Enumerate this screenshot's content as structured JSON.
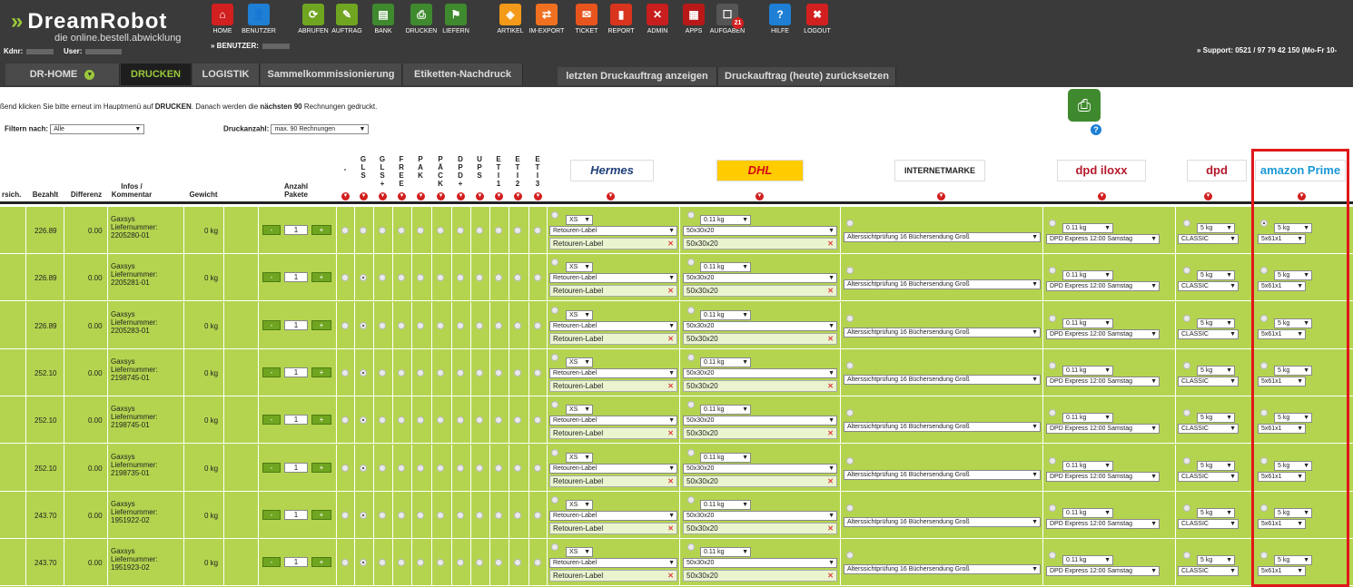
{
  "brand": {
    "name": "DreamRobot",
    "tagline": "die online.bestell.abwicklung"
  },
  "account": {
    "kdnr_label": "Kdnr:",
    "user_label": "User:",
    "benutzer_label": "» BENUTZER:"
  },
  "support": "» Support: 0521 / 97 79 42 150 (Mo-Fr 10-",
  "nav": [
    {
      "label": "HOME",
      "icon": "home-icon",
      "glyph": "⌂",
      "color": "#d21f1f"
    },
    {
      "label": "BENUTZER",
      "icon": "users-icon",
      "glyph": "👤",
      "color": "#1e7fd4"
    },
    {
      "label": "ABRUFEN",
      "icon": "download-icon",
      "glyph": "⟳",
      "color": "#6fa520"
    },
    {
      "label": "AUFTRAG",
      "icon": "order-icon",
      "glyph": "✎",
      "color": "#6fa520"
    },
    {
      "label": "BANK",
      "icon": "bank-icon",
      "glyph": "▤",
      "color": "#3f8a2e"
    },
    {
      "label": "DRUCKEN",
      "icon": "printer-icon",
      "glyph": "⎙",
      "color": "#3f8a2e"
    },
    {
      "label": "LIEFERN",
      "icon": "delivery-icon",
      "glyph": "⚑",
      "color": "#3f8a2e"
    },
    {
      "label": "ARTIKEL",
      "icon": "box-icon",
      "glyph": "◈",
      "color": "#f39a1a"
    },
    {
      "label": "IM-EXPORT",
      "icon": "import-export-icon",
      "glyph": "⇄",
      "color": "#f07020"
    },
    {
      "label": "TICKET",
      "icon": "mail-icon",
      "glyph": "✉",
      "color": "#e8541e"
    },
    {
      "label": "REPORT",
      "icon": "chart-icon",
      "glyph": "▮",
      "color": "#d9341e"
    },
    {
      "label": "ADMIN",
      "icon": "tools-icon",
      "glyph": "✕",
      "color": "#c81e1e"
    },
    {
      "label": "APPS",
      "icon": "apps-icon",
      "glyph": "▦",
      "color": "#b81818"
    },
    {
      "label": "AUFGABEN",
      "icon": "tasks-icon",
      "glyph": "☐",
      "color": "#555555",
      "badge": "21"
    },
    {
      "label": "HILFE",
      "icon": "help-icon",
      "glyph": "?",
      "color": "#1e7fd4"
    },
    {
      "label": "LOGOUT",
      "icon": "logout-icon",
      "glyph": "✖",
      "color": "#d21f1f"
    }
  ],
  "tabs": [
    "DR-HOME",
    "DRUCKEN",
    "LOGISTIK",
    "Sammelkommissionierung",
    "Etiketten-Nachdruck"
  ],
  "actions": [
    "letzten Druckauftrag anzeigen",
    "Druckauftrag (heute) zurücksetzen"
  ],
  "info": {
    "pre": "ßend klicken Sie bitte erneut im Hauptmenü auf ",
    "b1": "DRUCKEN",
    "mid": ". Danach werden die ",
    "b2": "nächsten 90",
    "post": " Rechnungen gedruckt."
  },
  "filter": {
    "label": "Filtern nach:",
    "value": "Alle"
  },
  "druckanzahl": {
    "label": "Druckanzahl:",
    "value": "max. 90 Rechnungen"
  },
  "headers": {
    "versich": "rsich.",
    "bezahlt": "Bezahlt",
    "differenz": "Differenz",
    "infos": "Infos /\nKommentar",
    "gewicht": "Gewicht",
    "pakete": "Anzahl\nPakete"
  },
  "carrier_cols": [
    "-",
    "G\nL\nS",
    "G\nL\nS\n+",
    "F\nR\nE\nE",
    "P\nA\nK",
    "P\nÄ\nC\nK",
    "D\nP\nD\n+",
    "U\nP\nS",
    "E\nT\nI\n1",
    "E\nT\nI\n2",
    "E\nT\nI\n3"
  ],
  "carriers": [
    {
      "name": "Hermes",
      "color": "#1d3e7a",
      "bg": "#fff"
    },
    {
      "name": "DHL",
      "color": "#d40511",
      "bg": "#ffcc00"
    },
    {
      "name": "INTERNETMARKE",
      "color": "#222",
      "bg": "#fff"
    },
    {
      "name": "dpd iloxx",
      "color": "#b3192b",
      "bg": "#fff"
    },
    {
      "name": "dpd",
      "color": "#b3192b",
      "bg": "#fff"
    },
    {
      "name": "amazon Prime",
      "color": "#1a98d5",
      "bg": "#fff"
    }
  ],
  "rows": [
    {
      "bezahlt": "226.89",
      "differenz": "0.00",
      "info1": "Gaxsys",
      "info2": "Liefernummer:",
      "info3": "2205280-01",
      "gewicht": "0 kg",
      "pakete": "1"
    },
    {
      "bezahlt": "226.89",
      "differenz": "0.00",
      "info1": "Gaxsys",
      "info2": "Liefernummer:",
      "info3": "2205281-01",
      "gewicht": "0 kg",
      "pakete": "1"
    },
    {
      "bezahlt": "226.89",
      "differenz": "0.00",
      "info1": "Gaxsys",
      "info2": "Liefernummer:",
      "info3": "2205283-01",
      "gewicht": "0 kg",
      "pakete": "1"
    },
    {
      "bezahlt": "252.10",
      "differenz": "0.00",
      "info1": "Gaxsys",
      "info2": "Liefernummer:",
      "info3": "2198745-01",
      "gewicht": "0 kg",
      "pakete": "1"
    },
    {
      "bezahlt": "252.10",
      "differenz": "0.00",
      "info1": "Gaxsys",
      "info2": "Liefernummer:",
      "info3": "2198745-01",
      "gewicht": "0 kg",
      "pakete": "1"
    },
    {
      "bezahlt": "252.10",
      "differenz": "0.00",
      "info1": "Gaxsys",
      "info2": "Liefernummer:",
      "info3": "2198735-01",
      "gewicht": "0 kg",
      "pakete": "1"
    },
    {
      "bezahlt": "243.70",
      "differenz": "0.00",
      "info1": "Gaxsys",
      "info2": "Liefernummer:",
      "info3": "1951922-02",
      "gewicht": "0 kg",
      "pakete": "1"
    },
    {
      "bezahlt": "243.70",
      "differenz": "0.00",
      "info1": "Gaxsys",
      "info2": "Liefernummer:",
      "info3": "1951923-02",
      "gewicht": "0 kg",
      "pakete": "1"
    }
  ],
  "row_defaults": {
    "minus": "-",
    "plus": "+",
    "hermes_size": "XS",
    "hermes_label": "Retouren-Label",
    "hermes_input": "Retouren-Label",
    "dhl_weight": "0.11 kg",
    "dhl_size": "50x30x20",
    "dhl_input": "50x30x20",
    "internetmarke": "Alterssichtprüfung 16 Büchersendung Groß",
    "iloxx_weight": "0.11 kg",
    "iloxx_service": "DPD Express 12:00 Samstag",
    "dpd_weight": "5 kg",
    "dpd_service": "CLASSIC",
    "amazon_weight": "5 kg",
    "amazon_size": "5x61x1"
  }
}
